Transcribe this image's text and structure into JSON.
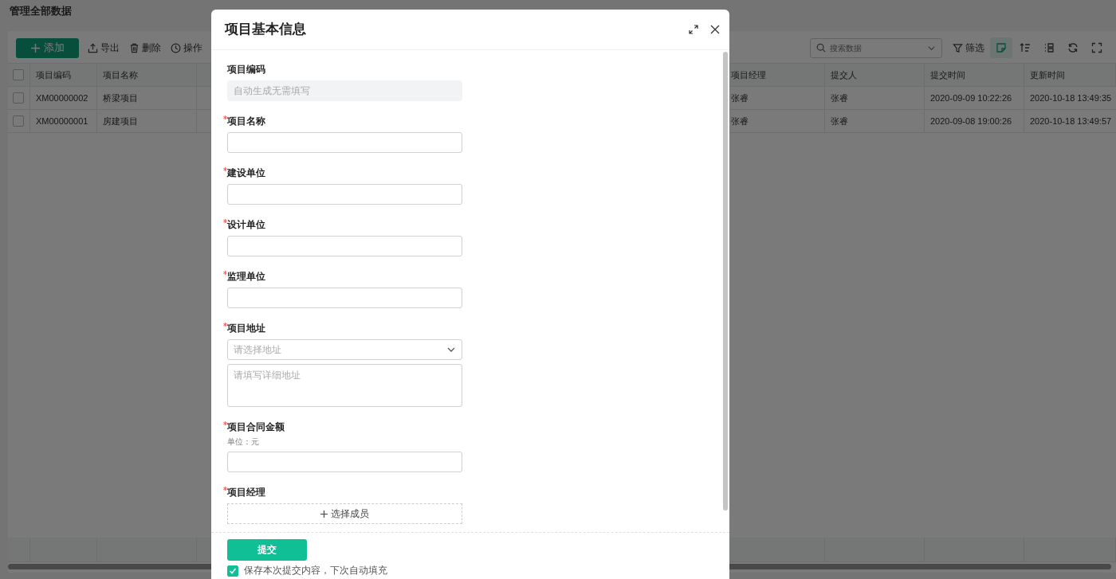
{
  "page": {
    "title": "管理全部数据"
  },
  "toolbar": {
    "add_button": "添加",
    "actions": [
      "导出",
      "删除",
      "操作"
    ],
    "search": {
      "placeholder": "搜索数据"
    },
    "filter": "筛选",
    "view_toggles": [
      {
        "active": true
      },
      {
        "active": false
      },
      {
        "active": false
      },
      {
        "active": false
      },
      {
        "active": false
      }
    ]
  },
  "table": {
    "all_selected": false,
    "columns": [
      "项目编码",
      "项目名称",
      "项目经理",
      "提交人",
      "提交时间",
      "更新时间"
    ],
    "rows": [
      {
        "selected": false,
        "cells": [
          "XM00000002",
          "桥梁项目",
          "张睿",
          "张睿",
          "2020-09-09 10:22:26",
          "2020-10-18 13:49:35"
        ]
      },
      {
        "selected": false,
        "cells": [
          "XM00000001",
          "房建项目",
          "张睿",
          "张睿",
          "2020-09-08 19:00:26",
          "2020-10-18 13:49:57"
        ]
      }
    ]
  },
  "dialog": {
    "title": "项目基本信息",
    "fields": [
      {
        "kind": "auto",
        "label": "项目编码",
        "required": false,
        "placeholder": "自动生成无需填写"
      },
      {
        "kind": "text",
        "label": "项目名称",
        "required": true
      },
      {
        "kind": "text",
        "label": "建设单位",
        "required": true
      },
      {
        "kind": "text",
        "label": "设计单位",
        "required": true
      },
      {
        "kind": "text",
        "label": "监理单位",
        "required": true
      },
      {
        "kind": "address",
        "label": "项目地址",
        "required": true,
        "select_placeholder": "请选择地址",
        "detail_placeholder": "请填写详细地址"
      },
      {
        "kind": "text",
        "label": "项目合同金额",
        "required": true,
        "hint": "单位：元"
      },
      {
        "kind": "member",
        "label": "项目经理",
        "required": true,
        "button": "选择成员"
      }
    ],
    "submit": "提交",
    "remember": {
      "label": "保存本次提交内容，下次自动填充",
      "checked": true
    }
  }
}
